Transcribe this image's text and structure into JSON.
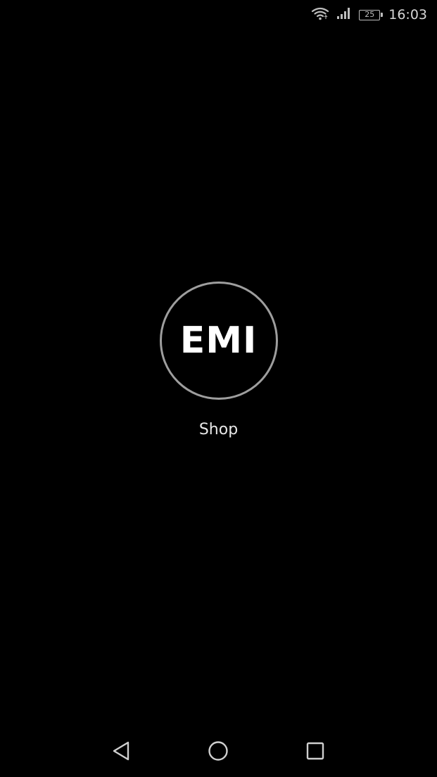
{
  "status_bar": {
    "battery_level": "25",
    "time": "16:03",
    "icons": [
      "wifi-icon",
      "cellular-signal-icon",
      "battery-icon"
    ]
  },
  "splash": {
    "logo_text": "EMI",
    "caption": "Shop",
    "colors": {
      "background": "#000000",
      "ring": "#9e9e9e",
      "text": "#ffffff"
    }
  },
  "nav_bar": {
    "buttons": [
      "back-icon",
      "home-icon",
      "recents-icon"
    ]
  }
}
